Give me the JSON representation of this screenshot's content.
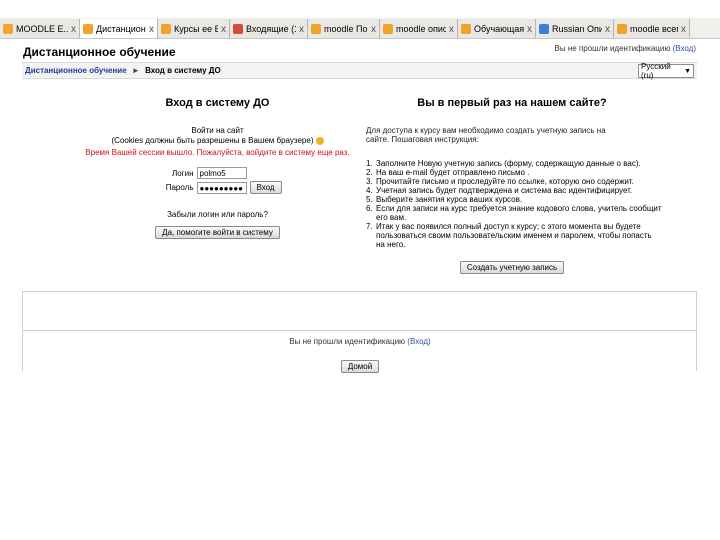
{
  "tabs": [
    {
      "label": "MOODLE  E...",
      "icon": "moodle-icon",
      "active": false
    },
    {
      "label": "Дистанцион...",
      "icon": "moodle-icon",
      "active": true
    },
    {
      "label": "Курсы ее В ...",
      "icon": "moodle-icon",
      "active": false
    },
    {
      "label": "Входящие (1 ...",
      "icon": "gmail-icon",
      "active": false
    },
    {
      "label": "moodle  По...",
      "icon": "moodle-icon",
      "active": false
    },
    {
      "label": "moodle  опис...",
      "icon": "moodle-icon",
      "active": false
    },
    {
      "label": "Обучающая ...",
      "icon": "moodle-icon",
      "active": false
    },
    {
      "label": "Russian  Опис...",
      "icon": "web-icon",
      "active": false
    },
    {
      "label": "moodle  всем...",
      "icon": "moodle-icon",
      "active": false
    }
  ],
  "tab_close_glyph": "x",
  "header": {
    "site_title": "Дистанционное обучение",
    "login_status": "Вы не прошли идентификацию",
    "login_link": "(Вход)",
    "language": "Русский (ru)"
  },
  "breadcrumb": {
    "home": "Дистанционное обучение",
    "separator": "►",
    "current": "Вход в систему ДО"
  },
  "login": {
    "heading": "Вход в систему ДО",
    "subheading": "Войти на сайт",
    "cookies_note": "(Cookies должны быть разрешены в Вашем браузере)",
    "error": "Время Вашей сессии вышло. Пожалуйста, войдите в систему еще раз.",
    "username_label": "Логин",
    "username_value": "polmo5",
    "password_label": "Пароль",
    "password_value": "●●●●●●●●●",
    "submit_label": "Вход",
    "forgot_text": "Забыли логин или пароль?",
    "guest_button": "Да, помогите войти в систему"
  },
  "firsttime": {
    "heading": "Вы в первый раз на нашем сайте?",
    "intro": "Для доступа к курсу вам необходимо создать учетную запись на сайте. Пошаговая инструкция:",
    "steps": [
      {
        "num": "1.",
        "text": "Заполните Новую учетную запись (форму, содержащую данные о вас)."
      },
      {
        "num": "2.",
        "text": "На ваш e-mail будет отправлено письмо ."
      },
      {
        "num": "3.",
        "text": "Прочитайте письмо и проследуйте по ссылке, которую оно содержит."
      },
      {
        "num": "4.",
        "text": "Учетная запись будет подтверждена и система вас идентифицирует."
      },
      {
        "num": "5.",
        "text": "Выберите занятия курса ваших курсов."
      },
      {
        "num": "6.",
        "text": "Если для записи на курс требуется знание кодового слова, учитель сообщит его вам."
      },
      {
        "num": "7.",
        "text": "Итак у вас появился полный доступ к курсу; с этого момента вы будете пользоваться своим пользовательским именем и паролем, чтобы попасть на него."
      }
    ],
    "create_button": "Создать учетную запись"
  },
  "footer": {
    "login_status": "Вы не прошли идентификацию",
    "login_link": "(Вход)",
    "home_button": "Домой"
  }
}
